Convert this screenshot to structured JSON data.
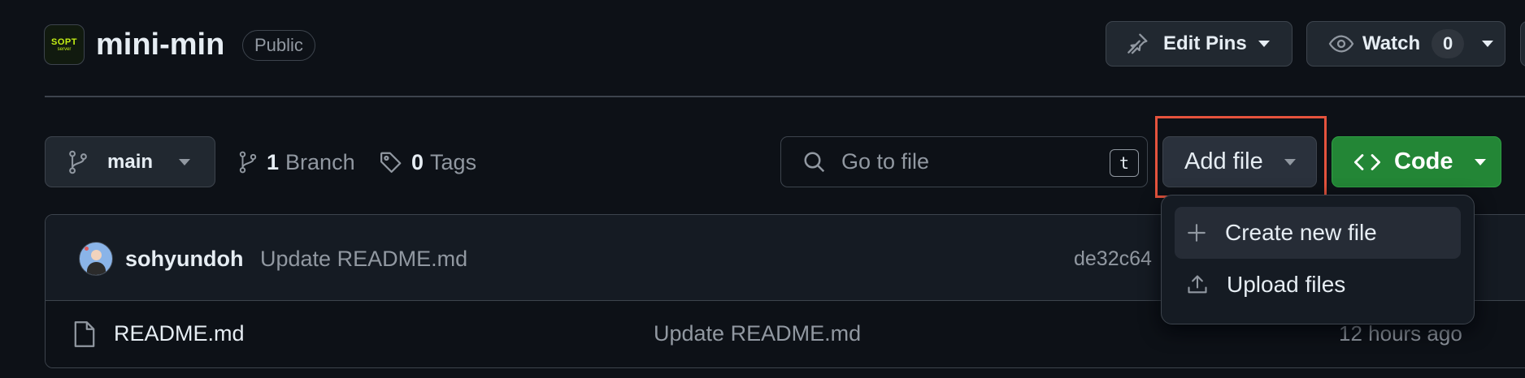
{
  "repo": {
    "logo_text": "SOPT",
    "logo_subtext": "server",
    "name": "mini-min",
    "visibility": "Public"
  },
  "header_actions": {
    "edit_pins_label": "Edit Pins",
    "watch_label": "Watch",
    "watch_count": "0"
  },
  "toolbar": {
    "branch_name": "main",
    "branch_count": "1",
    "branch_label": "Branch",
    "tag_count": "0",
    "tag_label": "Tags",
    "goto_placeholder": "Go to file",
    "goto_shortcut": "t",
    "add_file_label": "Add file",
    "code_label": "Code"
  },
  "dropdown": {
    "items": [
      {
        "label": "Create new file",
        "icon": "plus-icon"
      },
      {
        "label": "Upload files",
        "icon": "upload-icon"
      }
    ]
  },
  "latest_commit": {
    "author": "sohyundoh",
    "message": "Update README.md",
    "hash": "de32c64"
  },
  "files": [
    {
      "name": "README.md",
      "icon": "file-icon",
      "commit_message": "Update README.md",
      "time": "12 hours ago"
    }
  ],
  "colors": {
    "background": "#0d1117",
    "code_button": "#238636",
    "highlight": "#e5533d"
  }
}
